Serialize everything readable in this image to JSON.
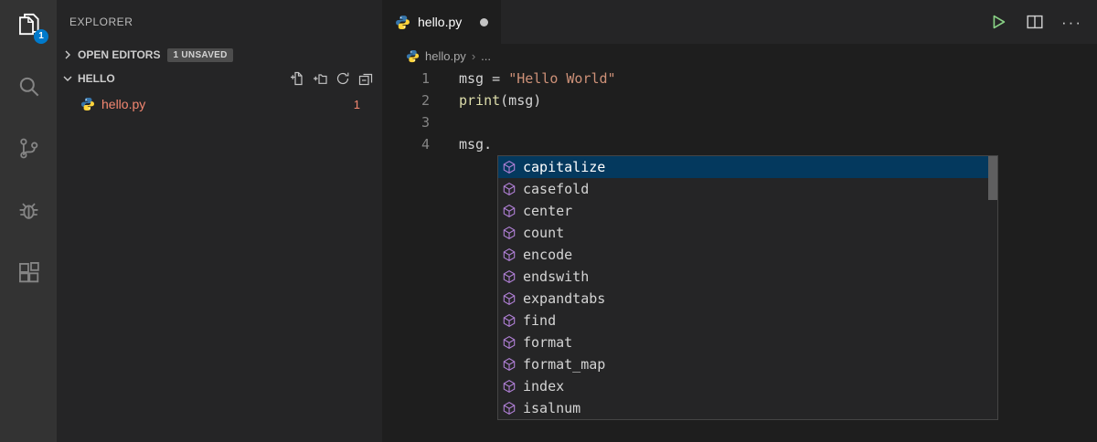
{
  "activity_bar": {
    "items": [
      {
        "id": "explorer",
        "icon": "files-icon",
        "active": true,
        "badge": "1"
      },
      {
        "id": "search",
        "icon": "search-icon"
      },
      {
        "id": "source-control",
        "icon": "source-control-icon"
      },
      {
        "id": "run-debug",
        "icon": "debug-icon"
      },
      {
        "id": "extensions",
        "icon": "extensions-icon"
      }
    ]
  },
  "sidebar": {
    "title": "EXPLORER",
    "open_editors": {
      "label": "OPEN EDITORS",
      "badge": "1 UNSAVED"
    },
    "folder_section": {
      "label": "HELLO",
      "actions": [
        "new-file-icon",
        "new-folder-icon",
        "refresh-icon",
        "collapse-all-icon"
      ]
    },
    "files": [
      {
        "name": "hello.py",
        "badge": "1"
      }
    ]
  },
  "editor": {
    "tabs": [
      {
        "label": "hello.py",
        "dirty": true
      }
    ],
    "breadcrumb": {
      "file": "hello.py",
      "separator": "›",
      "symbol": "..."
    },
    "actions": {
      "more": "···"
    },
    "code": {
      "lines": [
        {
          "num": "1",
          "tokens": [
            {
              "t": "msg = ",
              "c": "plain"
            },
            {
              "t": "\"Hello World\"",
              "c": "string"
            }
          ]
        },
        {
          "num": "2",
          "tokens": [
            {
              "t": "print",
              "c": "func"
            },
            {
              "t": "(msg)",
              "c": "plain"
            }
          ]
        },
        {
          "num": "3",
          "tokens": []
        },
        {
          "num": "4",
          "tokens": [
            {
              "t": "msg.",
              "c": "plain"
            }
          ]
        }
      ]
    },
    "suggest": {
      "selected_index": 0,
      "items": [
        "capitalize",
        "casefold",
        "center",
        "count",
        "encode",
        "endswith",
        "expandtabs",
        "find",
        "format",
        "format_map",
        "index",
        "isalnum"
      ]
    }
  },
  "colors": {
    "accent_badge": "#007acc",
    "list_selection": "#04395e",
    "error_file": "#f48771",
    "string": "#ce9178",
    "function": "#dcdcaa",
    "run_green": "#89d185",
    "method_icon": "#b180d7"
  }
}
